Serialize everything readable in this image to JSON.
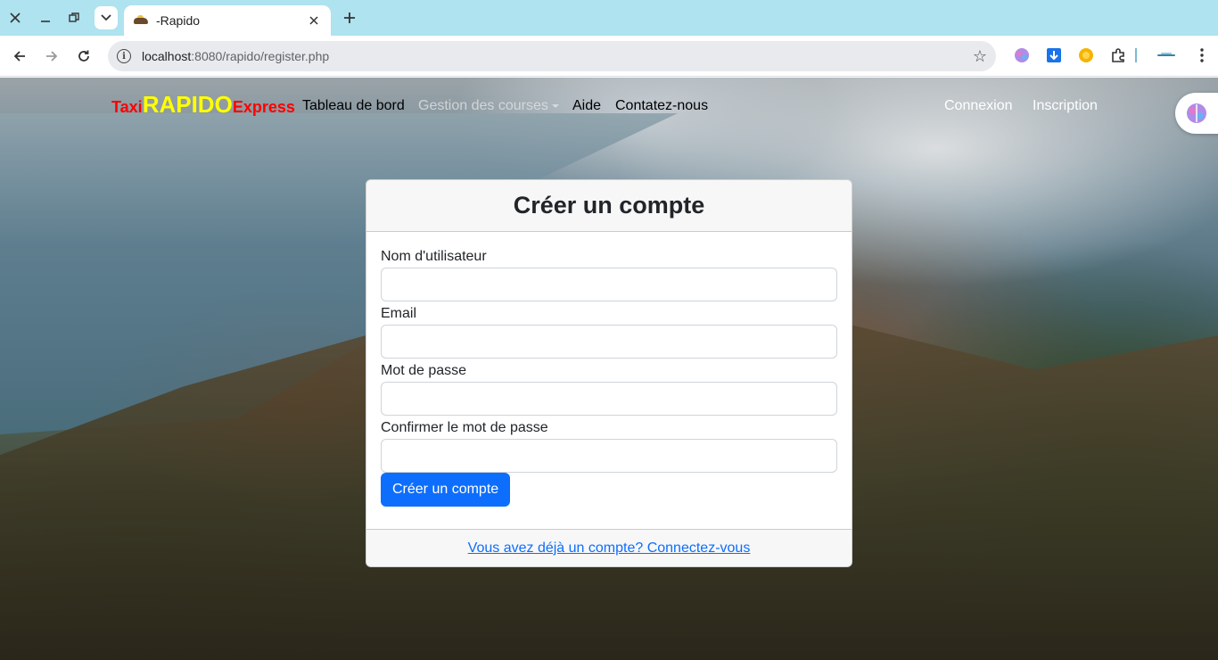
{
  "browser": {
    "tab": {
      "title": "-Rapido"
    },
    "address": {
      "host": "localhost",
      "path": ":8080/rapido/register.php"
    }
  },
  "navbar": {
    "brand": {
      "taxi": "Taxi",
      "rapido": "RAPIDO",
      "express": "Express"
    },
    "links": {
      "dashboard": "Tableau de bord",
      "courses": "Gestion des courses",
      "help": "Aide",
      "contact": "Contatez-nous"
    },
    "right": {
      "login": "Connexion",
      "register": "Inscription"
    }
  },
  "form": {
    "title": "Créer un compte",
    "username_label": "Nom d'utilisateur",
    "email_label": "Email",
    "password_label": "Mot de passe",
    "confirm_label": "Confirmer le mot de passe",
    "submit": "Créer un compte",
    "footer_link": "Vous avez déjà un compte? Connectez-vous"
  },
  "colors": {
    "primary": "#0d6efd",
    "brand_red": "#ff0000",
    "brand_yellow": "#ffff00",
    "tabstrip": "#aee3ef"
  }
}
